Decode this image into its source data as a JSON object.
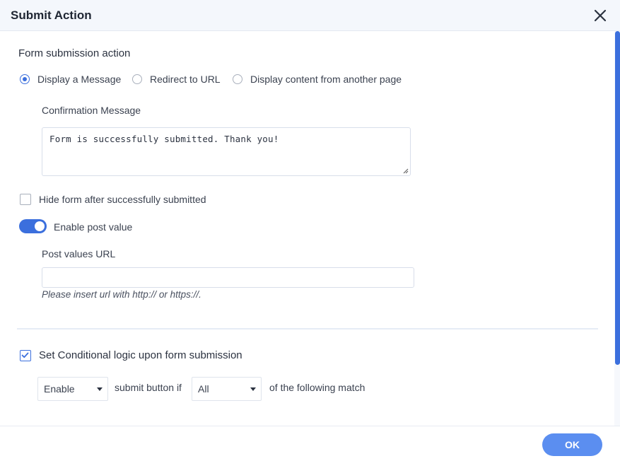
{
  "dialog": {
    "title": "Submit Action",
    "close_icon": "close-icon"
  },
  "form_action": {
    "section_title": "Form submission action",
    "options": [
      {
        "label": "Display a Message",
        "checked": true
      },
      {
        "label": "Redirect to URL",
        "checked": false
      },
      {
        "label": "Display content from another page",
        "checked": false
      }
    ],
    "confirmation_label": "Confirmation Message",
    "confirmation_value": "Form is successfully submitted. Thank you!"
  },
  "hide_form": {
    "label": "Hide form after successfully submitted",
    "checked": false
  },
  "post_value": {
    "toggle_label": "Enable post value",
    "enabled": true,
    "url_label": "Post values URL",
    "url_value": "",
    "hint": "Please insert url with http:// or https://."
  },
  "conditional": {
    "label": "Set Conditional logic upon form submission",
    "checked": true,
    "action_select": "Enable",
    "text_middle": "submit button if",
    "match_select": "All",
    "text_end": "of the following match"
  },
  "footer": {
    "ok_label": "OK"
  },
  "colors": {
    "accent": "#3b6fdd",
    "ok_button": "#5b8ef0",
    "header_bg": "#f4f7fc"
  }
}
